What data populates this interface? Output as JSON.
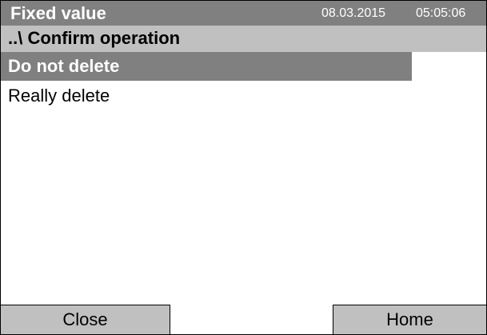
{
  "header": {
    "title": "Fixed value",
    "date": "08.03.2015",
    "time": "05:05:06"
  },
  "breadcrumb": {
    "text": "..\\ Confirm operation"
  },
  "options": [
    {
      "label": "Do not delete",
      "selected": true
    },
    {
      "label": "Really delete",
      "selected": false
    }
  ],
  "footer": {
    "close_label": "Close",
    "home_label": "Home"
  },
  "colors": {
    "title_bar": "#808080",
    "breadcrumb_bar": "#c0c0c0",
    "selection": "#808080",
    "button": "#c0c0c0"
  }
}
